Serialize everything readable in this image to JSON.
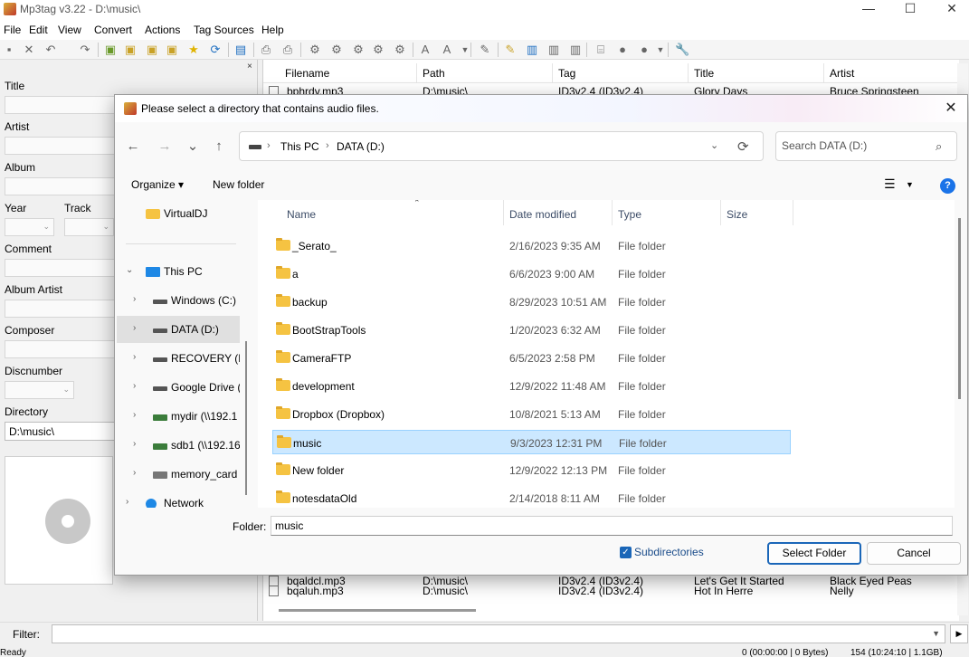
{
  "app": {
    "title": "Mp3tag v3.22  -  D:\\music\\",
    "minimize": "—",
    "maximize": "☐",
    "close": "✕"
  },
  "menu": [
    "File",
    "Edit",
    "View",
    "Convert",
    "Actions",
    "Tag Sources",
    "Help"
  ],
  "tag_panel": {
    "close": "×",
    "labels": {
      "title": "Title",
      "artist": "Artist",
      "album": "Album",
      "year": "Year",
      "track": "Track",
      "comment": "Comment",
      "album_artist": "Album Artist",
      "composer": "Composer",
      "discnumber": "Discnumber",
      "directory": "Directory"
    },
    "directory_value": "D:\\music\\"
  },
  "file_list": {
    "columns": [
      "Filename",
      "Path",
      "Tag",
      "Title",
      "Artist"
    ],
    "rows": [
      {
        "filename": "bphrdv.mp3",
        "path": "D:\\music\\",
        "tag": "ID3v2.4 (ID3v2.4)",
        "title": "Glory Days",
        "artist": "Bruce Springsteen"
      },
      {
        "filename": "bqaldcl.mp3",
        "path": "D:\\music\\",
        "tag": "ID3v2.4 (ID3v2.4)",
        "title": "Let's Get It Started",
        "artist": "Black Eyed Peas"
      },
      {
        "filename": "bqaluh.mp3",
        "path": "D:\\music\\",
        "tag": "ID3v2.4 (ID3v2.4)",
        "title": "Hot In Herre",
        "artist": "Nelly"
      }
    ]
  },
  "filter": {
    "label": "Filter:",
    "value": ""
  },
  "status": {
    "left": "Ready",
    "mid": "0 (00:00:00 | 0 Bytes)",
    "right": "154 (10:24:10 | 1.1GB)"
  },
  "dialog": {
    "title": "Please select a directory that contains audio files.",
    "close": "✕",
    "nav": {
      "back": "←",
      "forward": "→",
      "recent": "⌄",
      "up": "↑"
    },
    "breadcrumb": [
      "This PC",
      "DATA (D:)"
    ],
    "search_placeholder": "Search DATA (D:)",
    "organize": "Organize ▾",
    "new_folder": "New folder",
    "nav_pane": [
      {
        "label": "VirtualDJ",
        "icon": "folder-icon",
        "arrow": ""
      },
      {
        "label": "This PC",
        "icon": "pc-icon",
        "arrow": "⌄"
      },
      {
        "label": "Windows (C:)",
        "icon": "drive-icon",
        "arrow": "›"
      },
      {
        "label": "DATA (D:)",
        "icon": "drive-icon",
        "arrow": "›"
      },
      {
        "label": "RECOVERY (E:)",
        "icon": "drive-icon",
        "arrow": "›"
      },
      {
        "label": "Google Drive (",
        "icon": "drive-icon",
        "arrow": "›"
      },
      {
        "label": "mydir (\\\\192.1",
        "icon": "network-drive-icon",
        "arrow": "›"
      },
      {
        "label": "sdb1 (\\\\192.16",
        "icon": "network-drive-icon",
        "arrow": "›"
      },
      {
        "label": "memory_card",
        "icon": "memory-card-icon",
        "arrow": "›"
      },
      {
        "label": "Network",
        "icon": "network-icon",
        "arrow": "›"
      }
    ],
    "columns": {
      "name": "Name",
      "date": "Date modified",
      "type": "Type",
      "size": "Size"
    },
    "files": [
      {
        "name": "_Serato_",
        "date": "2/16/2023 9:35 AM",
        "type": "File folder"
      },
      {
        "name": "a",
        "date": "6/6/2023 9:00 AM",
        "type": "File folder"
      },
      {
        "name": "backup",
        "date": "8/29/2023 10:51 AM",
        "type": "File folder"
      },
      {
        "name": "BootStrapTools",
        "date": "1/20/2023 6:32 AM",
        "type": "File folder"
      },
      {
        "name": "CameraFTP",
        "date": "6/5/2023 2:58 PM",
        "type": "File folder"
      },
      {
        "name": "development",
        "date": "12/9/2022 11:48 AM",
        "type": "File folder"
      },
      {
        "name": "Dropbox (Dropbox)",
        "date": "10/8/2021 5:13 AM",
        "type": "File folder"
      },
      {
        "name": "music",
        "date": "9/3/2023 12:31 PM",
        "type": "File folder",
        "selected": true
      },
      {
        "name": "New folder",
        "date": "12/9/2022 12:13 PM",
        "type": "File folder"
      },
      {
        "name": "notesdataOld",
        "date": "2/14/2018 8:11 AM",
        "type": "File folder"
      }
    ],
    "folder_label": "Folder:",
    "folder_value": "music",
    "subdirectories_label": "Subdirectories",
    "subdirectories_checked": true,
    "select_button": "Select Folder",
    "cancel_button": "Cancel"
  }
}
